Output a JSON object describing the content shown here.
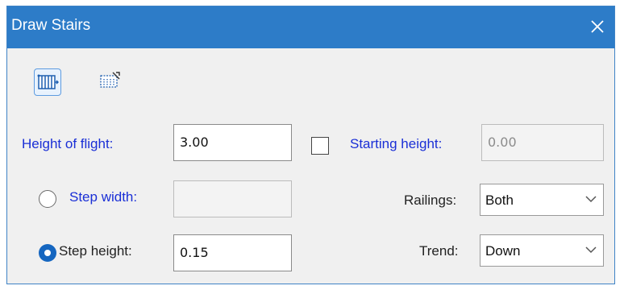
{
  "window": {
    "title": "Draw Stairs",
    "close_icon": "close-icon"
  },
  "toolbar": {
    "tools": [
      {
        "icon": "stairs-straight-icon",
        "active": true
      },
      {
        "icon": "stairs-from-points-icon",
        "active": false
      }
    ]
  },
  "form": {
    "height_of_flight": {
      "label": "Height of flight:",
      "value": "3.00"
    },
    "starting_height": {
      "label": "Starting height:",
      "value": "0.00",
      "checked": false
    },
    "step_width": {
      "label": "Step width:",
      "value": "",
      "selected": false
    },
    "step_height": {
      "label": "Step height:",
      "value": "0.15",
      "selected": true
    },
    "railings": {
      "label": "Railings:",
      "value": "Both"
    },
    "trend": {
      "label": "Trend:",
      "value": "Down"
    }
  },
  "colors": {
    "titlebar": "#2d7cc8",
    "label_blue": "#1a2fd6",
    "radio_selected": "#1566c0"
  }
}
